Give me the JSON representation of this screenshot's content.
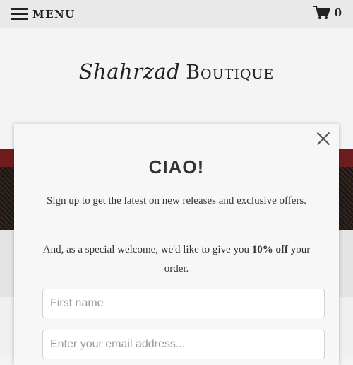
{
  "topbar": {
    "menu_label": "MENU",
    "menu_icon": "hamburger-icon",
    "cart_icon": "shopping-cart-icon",
    "cart_count": "0"
  },
  "header": {
    "logo_script": "Shahrzad",
    "logo_caps": "Boutique"
  },
  "modal": {
    "title": "CIAO!",
    "text1": "Sign up to get the latest on new releases and exclusive offers.",
    "text2_before": "And, as a special welcome, we'd like to give you ",
    "text2_bold": "10% off",
    "text2_after": " your order.",
    "first_name_placeholder": "First name",
    "email_placeholder": "Enter your email address...",
    "close_icon": "close-icon"
  },
  "colors": {
    "topbar_bg": "#e9e9e9",
    "hero_red": "#6e1c1e",
    "modal_bg": "#f7f7f7"
  }
}
